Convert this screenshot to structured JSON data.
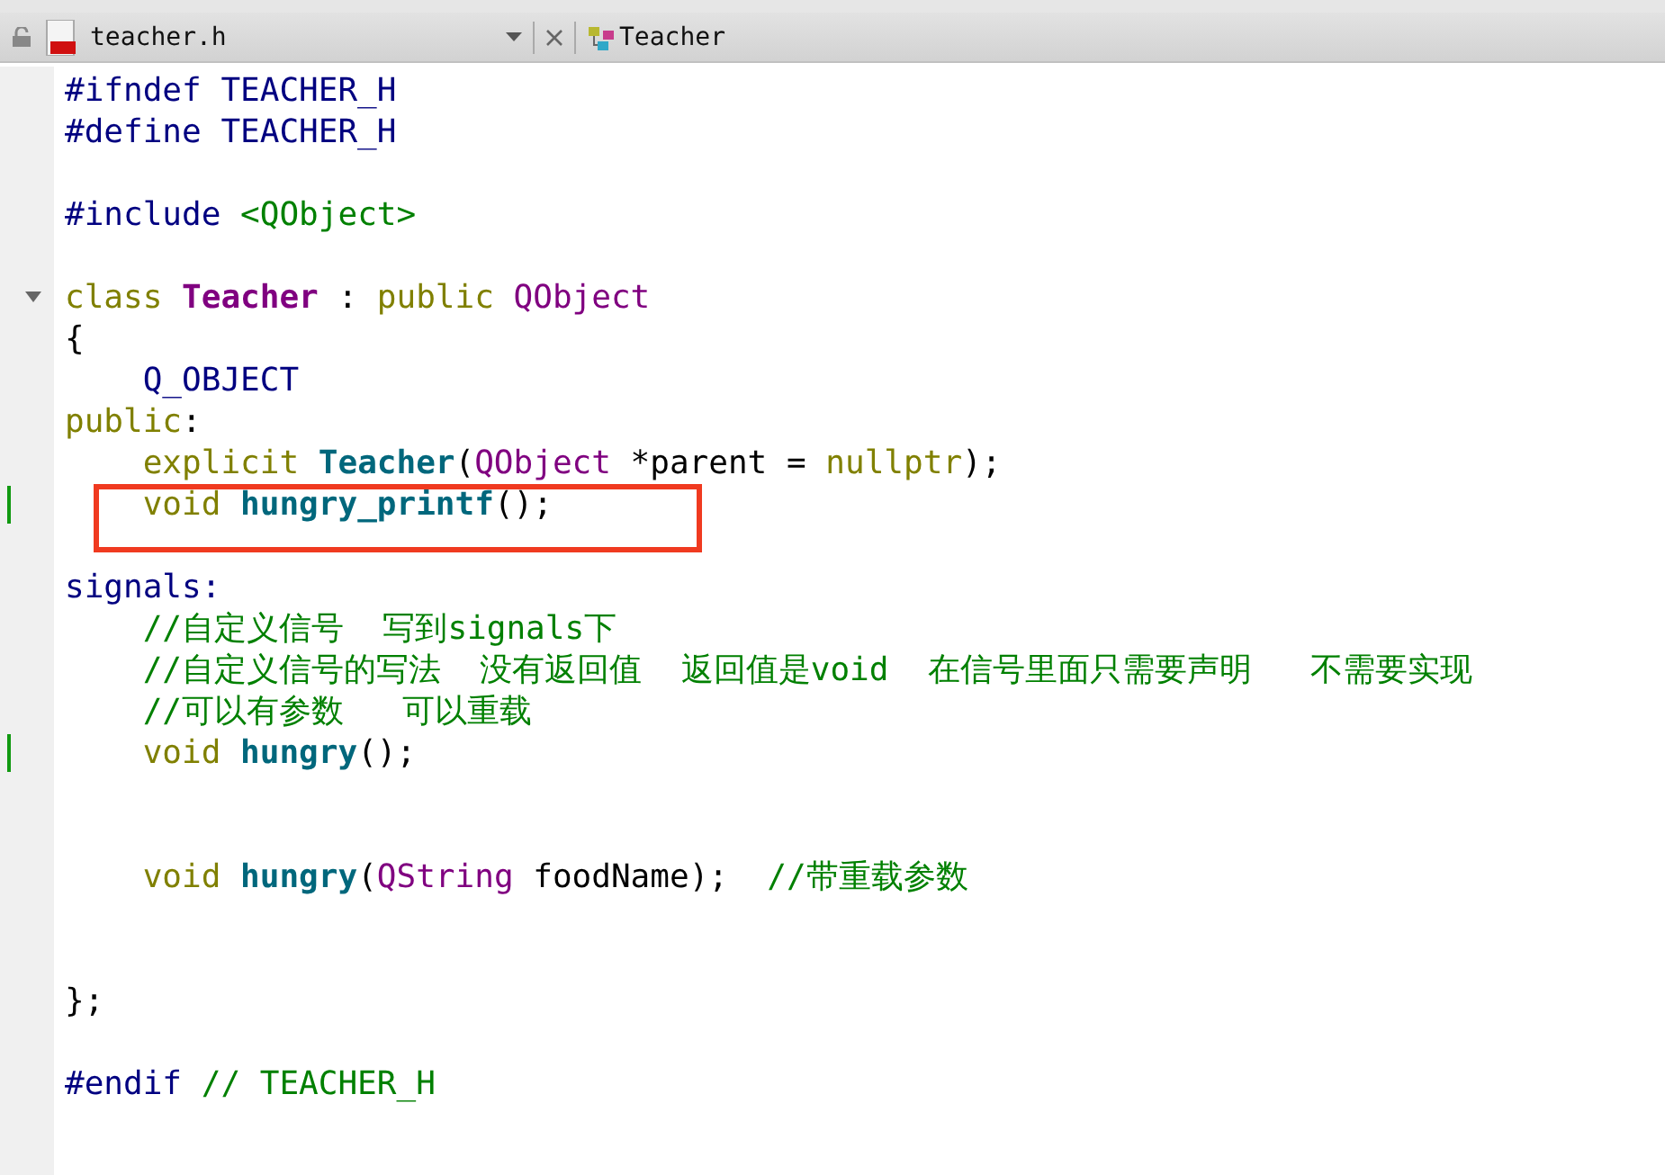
{
  "editor_tab": {
    "file_name": "teacher.h",
    "symbol": "Teacher"
  },
  "lines": [
    {
      "kind": "code",
      "tokens": [
        {
          "text": "#ifndef TEACHER_H",
          "kind": "preproc"
        }
      ]
    },
    {
      "kind": "code",
      "tokens": [
        {
          "text": "#define TEACHER_H",
          "kind": "preproc"
        }
      ]
    },
    {
      "kind": "blank"
    },
    {
      "kind": "code",
      "tokens": [
        {
          "text": "#include ",
          "kind": "preproc"
        },
        {
          "text": "<QObject>",
          "kind": "string"
        }
      ]
    },
    {
      "kind": "blank"
    },
    {
      "kind": "code",
      "foldable": true,
      "tokens": [
        {
          "text": "class ",
          "kind": "keyword"
        },
        {
          "text": "Teacher",
          "kind": "class"
        },
        {
          "text": " : ",
          "kind": "plain"
        },
        {
          "text": "public ",
          "kind": "keyword"
        },
        {
          "text": "QObject",
          "kind": "type"
        }
      ]
    },
    {
      "kind": "code",
      "tokens": [
        {
          "text": "{",
          "kind": "plain"
        }
      ]
    },
    {
      "kind": "code",
      "tokens": [
        {
          "text": "    Q_OBJECT",
          "kind": "macro"
        }
      ]
    },
    {
      "kind": "code",
      "tokens": [
        {
          "text": "public",
          "kind": "keyword"
        },
        {
          "text": ":",
          "kind": "plain"
        }
      ]
    },
    {
      "kind": "code",
      "tokens": [
        {
          "text": "    explicit ",
          "kind": "keyword"
        },
        {
          "text": "Teacher",
          "kind": "function"
        },
        {
          "text": "(",
          "kind": "plain"
        },
        {
          "text": "QObject",
          "kind": "type"
        },
        {
          "text": " *parent = ",
          "kind": "plain"
        },
        {
          "text": "nullptr",
          "kind": "keyword"
        },
        {
          "text": ");",
          "kind": "plain"
        }
      ]
    },
    {
      "kind": "code",
      "modified": true,
      "highlighted": true,
      "tokens": [
        {
          "text": "    void ",
          "kind": "keyword"
        },
        {
          "text": "hungry_printf",
          "kind": "function"
        },
        {
          "text": "();",
          "kind": "plain"
        }
      ]
    },
    {
      "kind": "blank"
    },
    {
      "kind": "code",
      "tokens": [
        {
          "text": "signals:",
          "kind": "macro"
        }
      ]
    },
    {
      "kind": "code",
      "tokens": [
        {
          "text": "    //自定义信号  写到signals下",
          "kind": "comment"
        }
      ]
    },
    {
      "kind": "code",
      "tokens": [
        {
          "text": "    //自定义信号的写法  没有返回值  返回值是void  在信号里面只需要声明   不需要实现",
          "kind": "comment"
        }
      ]
    },
    {
      "kind": "code",
      "tokens": [
        {
          "text": "    //可以有参数   可以重载",
          "kind": "comment"
        }
      ]
    },
    {
      "kind": "code",
      "modified": true,
      "tokens": [
        {
          "text": "    void ",
          "kind": "keyword"
        },
        {
          "text": "hungry",
          "kind": "function"
        },
        {
          "text": "();",
          "kind": "plain"
        }
      ]
    },
    {
      "kind": "blank"
    },
    {
      "kind": "blank"
    },
    {
      "kind": "code",
      "tokens": [
        {
          "text": "    void ",
          "kind": "keyword"
        },
        {
          "text": "hungry",
          "kind": "function"
        },
        {
          "text": "(",
          "kind": "plain"
        },
        {
          "text": "QString",
          "kind": "type"
        },
        {
          "text": " foodName);  ",
          "kind": "plain"
        },
        {
          "text": "//带重载参数",
          "kind": "comment"
        }
      ]
    },
    {
      "kind": "blank"
    },
    {
      "kind": "blank"
    },
    {
      "kind": "code",
      "tokens": [
        {
          "text": "};",
          "kind": "plain"
        }
      ]
    },
    {
      "kind": "blank"
    },
    {
      "kind": "code",
      "tokens": [
        {
          "text": "#endif ",
          "kind": "preproc"
        },
        {
          "text": "// TEACHER_H",
          "kind": "comment"
        }
      ]
    }
  ]
}
